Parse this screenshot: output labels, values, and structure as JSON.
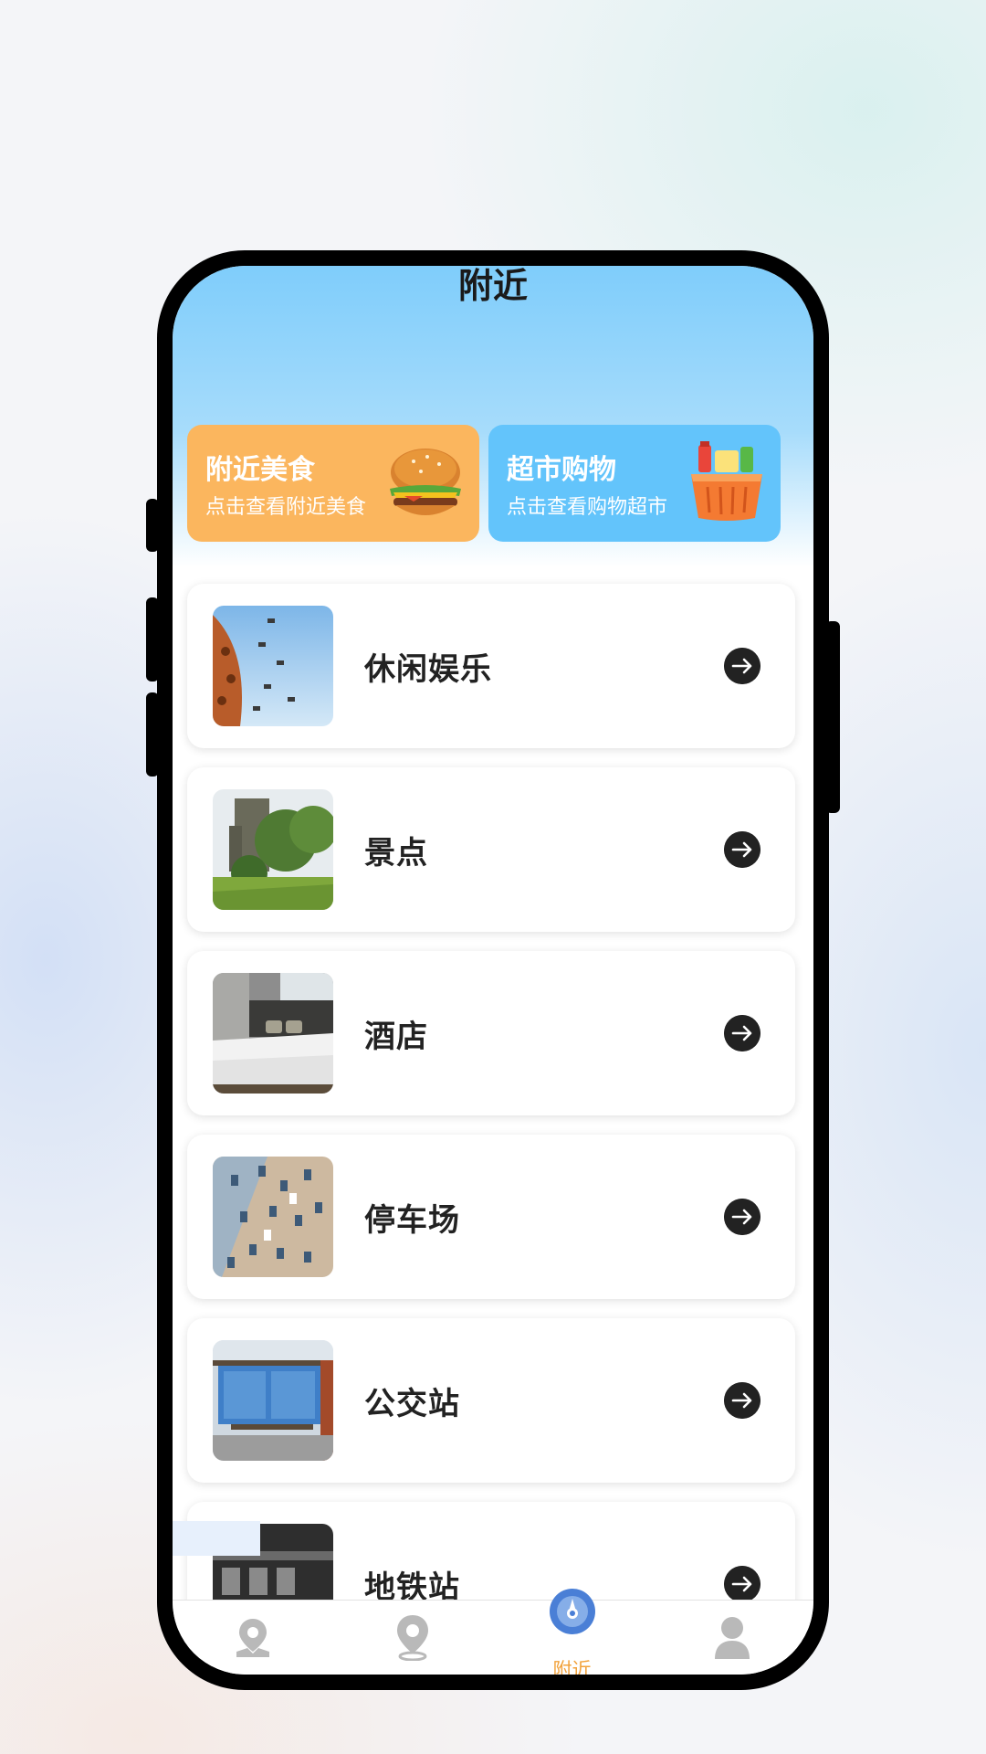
{
  "header": {
    "title": "附近"
  },
  "banners": [
    {
      "title": "附近美食",
      "subtitle": "点击查看附近美食",
      "icon": "burger-icon",
      "color": "#fbb65e"
    },
    {
      "title": "超市购物",
      "subtitle": "点击查看购物超市",
      "icon": "shopping-basket-icon",
      "color": "#63c4fb"
    }
  ],
  "categories": [
    {
      "label": "休闲娱乐",
      "image": "swing-ride-photo"
    },
    {
      "label": "景点",
      "image": "castle-park-photo"
    },
    {
      "label": "酒店",
      "image": "hotel-room-photo"
    },
    {
      "label": "停车场",
      "image": "parking-lot-photo"
    },
    {
      "label": "公交站",
      "image": "bus-stop-photo"
    },
    {
      "label": "地铁站",
      "image": "subway-station-photo"
    }
  ],
  "tabbar": {
    "active_index": 2,
    "active_color": "#f2a23b",
    "tabs": [
      {
        "icon": "map-pin-icon",
        "label": ""
      },
      {
        "icon": "location-icon",
        "label": ""
      },
      {
        "icon": "compass-icon",
        "label": "附近"
      },
      {
        "icon": "user-icon",
        "label": ""
      }
    ]
  }
}
